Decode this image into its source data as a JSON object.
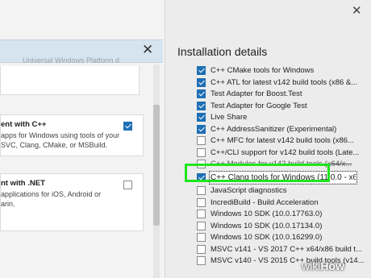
{
  "left_panel": {
    "faded_text": "Universal Windows Platform development",
    "card_top": {
      "checked": true
    },
    "card_cpp": {
      "title": "ent with C++",
      "desc_lines": [
        "apps for Windows using tools of your",
        "SVC, Clang, CMake, or MSBuild."
      ],
      "checked": true
    },
    "card_net": {
      "title": "nt with .NET",
      "desc_lines": [
        "applications for iOS, Android or",
        "arin."
      ],
      "checked": false
    }
  },
  "installation": {
    "title": "Installation details",
    "items": [
      {
        "label": "C++ CMake tools for Windows",
        "checked": true
      },
      {
        "label": "C++ ATL for latest v142 build tools (x86 &...",
        "checked": true
      },
      {
        "label": "Test Adapter for Boost.Test",
        "checked": true
      },
      {
        "label": "Test Adapter for Google Test",
        "checked": true
      },
      {
        "label": "Live Share",
        "checked": true
      },
      {
        "label": "C++ AddressSanitizer (Experimental)",
        "checked": true
      },
      {
        "label": "C++ MFC for latest v142 build tools (x86...",
        "checked": false
      },
      {
        "label": "C++/CLI support for v142 build tools (Late...",
        "checked": false
      },
      {
        "label": "C++ Modules for v142 build tools (x64/x...",
        "checked": false
      },
      {
        "label": "C++ Clang tools for Windows (11.0.0 - x64...",
        "checked": true
      },
      {
        "label": "JavaScript diagnostics",
        "checked": false
      },
      {
        "label": "IncrediBuild - Build Acceleration",
        "checked": false
      },
      {
        "label": "Windows 10 SDK (10.0.17763.0)",
        "checked": false
      },
      {
        "label": "Windows 10 SDK (10.0.17134.0)",
        "checked": false
      },
      {
        "label": "Windows 10 SDK (10.0.16299.0)",
        "checked": false
      },
      {
        "label": "MSVC v141 - VS 2017 C++ x64/x86 build t...",
        "checked": false
      },
      {
        "label": "MSVC v140 - VS 2015 C++ build tools (v14...",
        "checked": false
      }
    ]
  },
  "watermark": {
    "wiki": "wiki",
    "how": "How"
  },
  "colors": {
    "highlight": "#1ee51e",
    "checkbox_on": "#1f6fb5"
  }
}
